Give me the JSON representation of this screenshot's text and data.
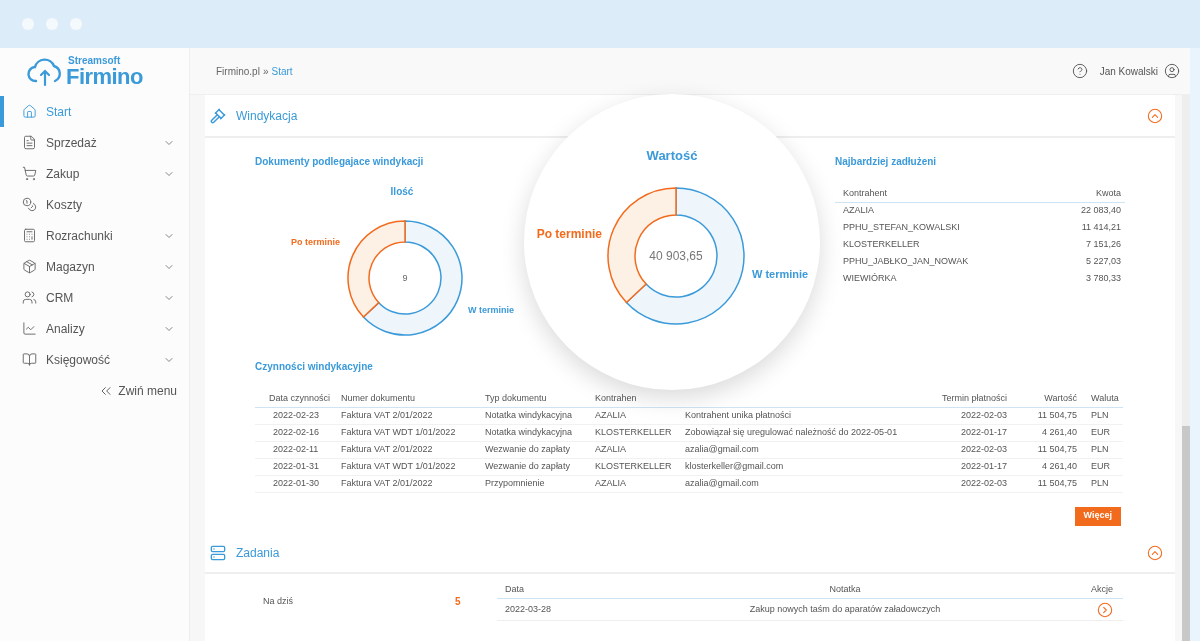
{
  "logo": {
    "brand": "Streamsoft",
    "product": "Firmino"
  },
  "sidebar": {
    "items": [
      {
        "label": "Start",
        "selected": true,
        "has_submenu": false
      },
      {
        "label": "Sprzedaż",
        "selected": false,
        "has_submenu": true
      },
      {
        "label": "Zakup",
        "selected": false,
        "has_submenu": true
      },
      {
        "label": "Koszty",
        "selected": false,
        "has_submenu": false
      },
      {
        "label": "Rozrachunki",
        "selected": false,
        "has_submenu": true
      },
      {
        "label": "Magazyn",
        "selected": false,
        "has_submenu": true
      },
      {
        "label": "CRM",
        "selected": false,
        "has_submenu": true
      },
      {
        "label": "Analizy",
        "selected": false,
        "has_submenu": true
      },
      {
        "label": "Księgowość",
        "selected": false,
        "has_submenu": true
      }
    ],
    "collapse": "Zwiń menu"
  },
  "header": {
    "breadcrumb": [
      {
        "label": "Firmino.pl",
        "selected": false
      },
      {
        "label": "»",
        "selected": false
      },
      {
        "label": "Start",
        "selected": true
      }
    ],
    "user": "Jan Kowalski"
  },
  "windykacja": {
    "title": "Windykacja",
    "expanded": true,
    "documents": {
      "title": "Dokumenty podlegajace windykacji",
      "chart_title": "Ilość",
      "center": "9",
      "overdue_label": "Po terminie",
      "ontime_label": "W terminie"
    },
    "value": {
      "chart_title": "Wartość",
      "center": "40 903,65",
      "overdue_label": "Po terminie",
      "ontime_label": "W terminie"
    },
    "debtors": {
      "title": "Najbardziej zadłużeni",
      "columns": [
        "Kontrahent",
        "Kwota"
      ],
      "rows": [
        [
          "AZALIA",
          "22 083,40"
        ],
        [
          "PPHU_STEFAN_KOWALSKI",
          "11 414,21"
        ],
        [
          "KLOSTERKELLER",
          "7 151,26"
        ],
        [
          "PPHU_JABŁKO_JAN_NOWAK",
          "5 227,03"
        ],
        [
          "WIEWIÓRKA",
          "3 780,33"
        ]
      ]
    },
    "actions": {
      "title": "Czynności windykacyjne",
      "columns": [
        {
          "label": "Data czynności"
        },
        {
          "label": "Numer dokumentu"
        },
        {
          "label": "Typ dokumentu"
        },
        {
          "label": "Kontrahen"
        },
        {},
        {
          "label": "Termin płatności"
        },
        {
          "label": "Wartość"
        },
        {
          "label": "Waluta"
        }
      ],
      "rows": [
        [
          "2022-02-23",
          "Faktura VAT 2/01/2022",
          "Notatka windykacyjna",
          "AZALIA",
          "Kontrahent unika płatności",
          "2022-02-03",
          "11 504,75",
          "PLN"
        ],
        [
          "2022-02-16",
          "Faktura VAT WDT 1/01/2022",
          "Notatka windykacyjna",
          "KLOSTERKELLER",
          "Zobowiązał się uregulować należność do 2022-05-01",
          "2022-01-17",
          "4 261,40",
          "EUR"
        ],
        [
          "2022-02-11",
          "Faktura VAT 2/01/2022",
          "Wezwanie do zapłaty",
          "AZALIA",
          "azalia@gmail.com",
          "2022-02-03",
          "11 504,75",
          "PLN"
        ],
        [
          "2022-01-31",
          "Faktura VAT WDT 1/01/2022",
          "Wezwanie do zapłaty",
          "KLOSTERKELLER",
          "klosterkeller@gmail.com",
          "2022-01-17",
          "4 261,40",
          "EUR"
        ],
        [
          "2022-01-30",
          "Faktura VAT 2/01/2022",
          "Przypomnienie",
          "AZALIA",
          "azalia@gmail.com",
          "2022-02-03",
          "11 504,75",
          "PLN"
        ]
      ],
      "more_button": "Więcej"
    }
  },
  "zadania": {
    "title": "Zadania",
    "expanded": true,
    "today_label": "Na dziś",
    "today_count": "5",
    "columns": [
      "Data",
      "Notatka",
      "Akcje"
    ],
    "rows": [
      [
        "2022-03-28",
        "Zakup nowych taśm do aparatów załadowczych"
      ]
    ]
  }
}
